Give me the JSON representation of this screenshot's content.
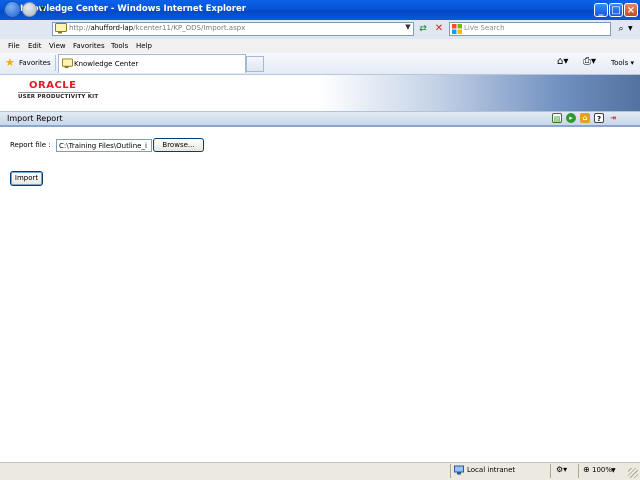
{
  "window": {
    "title": "Knowledge Center - Windows Internet Explorer",
    "minimize_icon": "minimize-icon",
    "maximize_icon": "maximize-icon",
    "close_icon": "close-icon"
  },
  "address_bar": {
    "url_prefix": "http://",
    "url_host": "ahufford-lap",
    "url_path": "/kcenter11/KP_ODS/Import.aspx",
    "search_placeholder": "Live Search"
  },
  "menu": {
    "items": [
      "File",
      "Edit",
      "View",
      "Favorites",
      "Tools",
      "Help"
    ]
  },
  "favorites_bar": {
    "favorites_label": "Favorites",
    "tab_label": "Knowledge Center",
    "tools_label": "Tools"
  },
  "page": {
    "logo_text": "ORACLE",
    "logo_subtitle": "USER PRODUCTIVITY KIT",
    "section_title": "Import Report",
    "section_icons": [
      "report-icon",
      "go-icon",
      "home-icon",
      "help-icon",
      "exit-icon"
    ],
    "report_file_label": "Report file :",
    "report_file_value": "C:\\Training Files\\Outline_i",
    "browse_label": "Browse...",
    "import_label": "Import"
  },
  "status_bar": {
    "zone": "Local intranet",
    "zoom": "100%"
  },
  "colors": {
    "titlebar": "#0754d6",
    "oracle_red": "#e31b23",
    "section_bar": "#c9d7ea"
  }
}
